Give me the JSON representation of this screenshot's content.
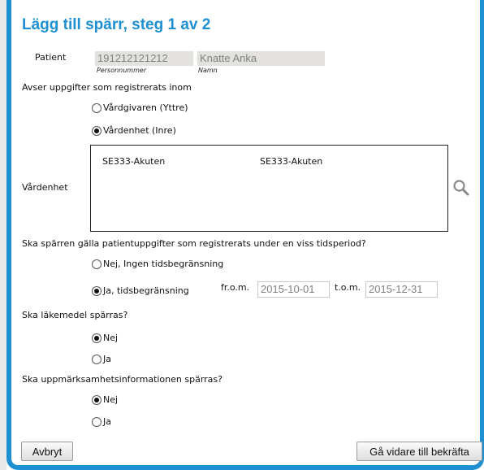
{
  "dialog": {
    "title": "Lägg till spärr, steg 1 av 2"
  },
  "patient": {
    "label": "Patient",
    "personnummer_value": "191212121212",
    "personnummer_caption": "Personnummer",
    "name_value": "Knatte Anka",
    "name_caption": "Namn"
  },
  "scope": {
    "question": "Avser uppgifter som registrerats inom",
    "options": [
      {
        "label": "Vårdgivaren (Yttre)",
        "selected": false
      },
      {
        "label": "Vårdenhet (Inre)",
        "selected": true
      }
    ]
  },
  "unit": {
    "label": "Vårdenhet",
    "rows": [
      {
        "id": "SE333-Akuten",
        "name": "SE333-Akuten"
      }
    ],
    "search_icon": "search-icon"
  },
  "period": {
    "question": "Ska spärren gälla patientuppgifter som registrerats under en viss tidsperiod?",
    "options": [
      {
        "label": "Nej, Ingen tidsbegränsning",
        "selected": false
      },
      {
        "label": "Ja, tidsbegränsning",
        "selected": true
      }
    ],
    "from_label": "fr.o.m.",
    "from_value": "2015-10-01",
    "to_label": "t.o.m.",
    "to_value": "2015-12-31"
  },
  "medication": {
    "question": "Ska läkemedel spärras?",
    "options": [
      {
        "label": "Nej",
        "selected": true
      },
      {
        "label": "Ja",
        "selected": false
      }
    ]
  },
  "alert": {
    "question": "Ska uppmärksamhetsinformationen spärras?",
    "options": [
      {
        "label": "Nej",
        "selected": true
      },
      {
        "label": "Ja",
        "selected": false
      }
    ]
  },
  "buttons": {
    "cancel": "Avbryt",
    "next": "Gå vidare till bekräfta"
  },
  "colors": {
    "accent": "#1e8fd0",
    "field_bg": "#e3e2de"
  }
}
